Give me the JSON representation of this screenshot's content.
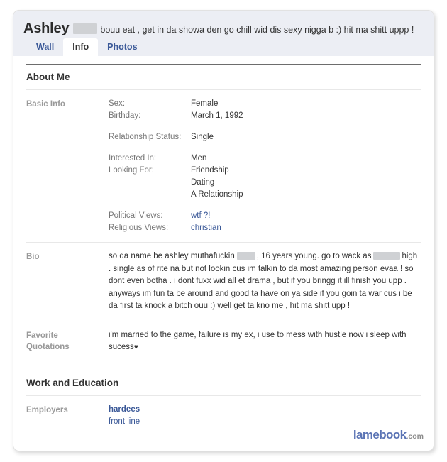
{
  "profile": {
    "name": "Ashley",
    "name_redacted": true,
    "status": "bouu eat , get in da showa den go chill wid dis sexy nigga b :) hit ma shitt uppp !"
  },
  "tabs": [
    {
      "label": "Wall",
      "active": false
    },
    {
      "label": "Info",
      "active": true
    },
    {
      "label": "Photos",
      "active": false
    }
  ],
  "sections": {
    "about_me": {
      "heading": "About Me",
      "basic_info": {
        "label": "Basic Info",
        "groups": [
          {
            "keys": [
              "Sex:",
              "Birthday:"
            ],
            "values": [
              "Female",
              "March 1, 1992"
            ]
          },
          {
            "keys": [
              "Relationship Status:"
            ],
            "values": [
              "Single"
            ]
          },
          {
            "keys": [
              "Interested In:",
              "Looking For:"
            ],
            "values": [
              "Men",
              "Friendship",
              "Dating",
              "A Relationship"
            ]
          },
          {
            "keys": [
              "Political Views:",
              "Religious Views:"
            ],
            "values": [
              "wtf ?!",
              "christian"
            ]
          }
        ]
      },
      "bio": {
        "label": "Bio",
        "part1": "so da name be ashley muthafuckin",
        "part2": ", 16 years young. go to wack as",
        "part3": "high . single as of rite na but not lookin cus im talkin to da most amazing person evaa ! so dont even botha . i dont fuxx wid all et drama , but if you bringg it ill finish you upp . anyways im fun ta be around and good ta have on ya side if you goin ta war cus i be da first ta knock a bitch ouu :) well get ta kno me , hit ma shitt upp !"
      },
      "favorite_quotations": {
        "label_line1": "Favorite",
        "label_line2": "Quotations",
        "text": "i'm married to the game, failure is my ex, i use to mess with hustle now i sleep with sucess",
        "heart": "♥"
      }
    },
    "work_and_education": {
      "heading": "Work and Education",
      "employers": {
        "label": "Employers",
        "company": "hardees",
        "position": "front line"
      }
    }
  },
  "watermark": {
    "brand": "lamebook",
    "tld": ".com"
  },
  "colors": {
    "link": "#3b5998",
    "header_bg": "#eceef4",
    "redaction": "#cfd1d4",
    "watermark": "#5a73b4"
  }
}
